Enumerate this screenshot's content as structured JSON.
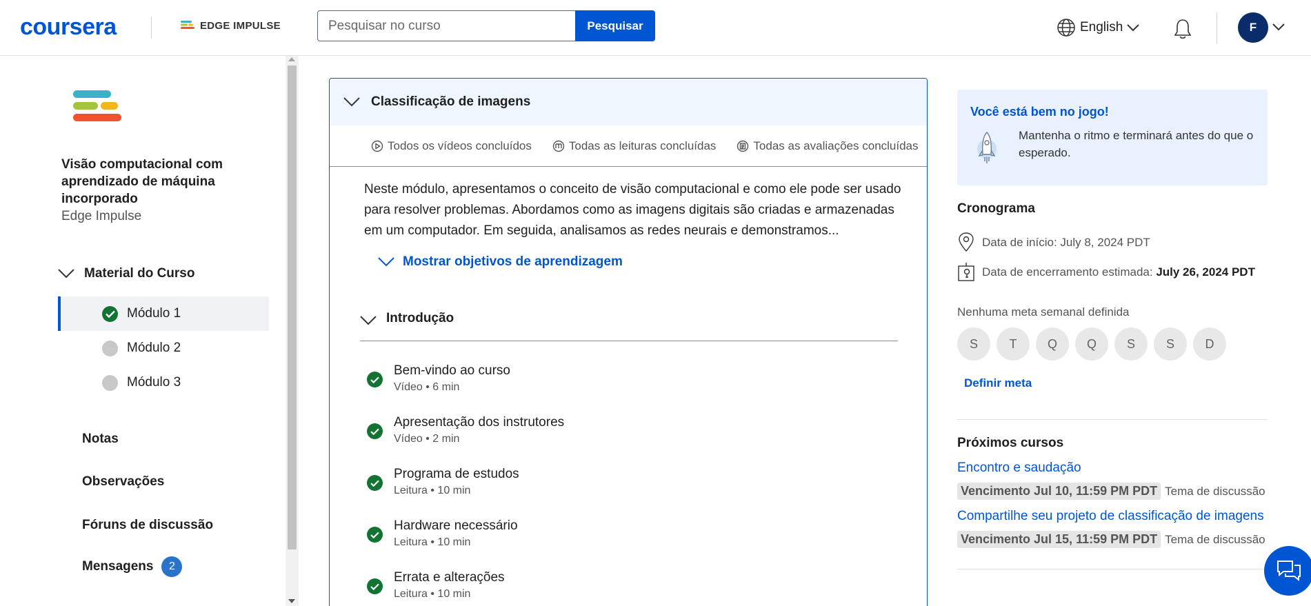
{
  "header": {
    "logo": "coursera",
    "partner_logo": "EDGE IMPULSE",
    "search_placeholder": "Pesquisar no curso",
    "search_button": "Pesquisar",
    "language": "English",
    "avatar_initial": "F"
  },
  "sidebar": {
    "course_title": "Visão computacional com aprendizado de máquina incorporado",
    "course_partner": "Edge Impulse",
    "material_label": "Material do Curso",
    "modules": [
      {
        "label": "Módulo 1",
        "status": "completed"
      },
      {
        "label": "Módulo 2",
        "status": "not-started"
      },
      {
        "label": "Módulo 3",
        "status": "not-started"
      }
    ],
    "links": {
      "notas": "Notas",
      "observacoes": "Observações",
      "foruns": "Fóruns de discussão",
      "mensagens": "Mensagens",
      "mensagens_count": "2"
    }
  },
  "module_card": {
    "title": "Classificação de imagens",
    "summary": {
      "videos": "Todos os vídeos concluídos",
      "readings": "Todas as leituras concluídas",
      "assessments": "Todas as avaliações concluídas"
    },
    "description": "Neste módulo, apresentamos o conceito de visão computacional e como ele pode ser usado para resolver problemas. Abordamos como as imagens digitais são criadas e armazenadas em um computador. Em seguida, analisamos as redes neurais e demonstramos...",
    "objectives_link": "Mostrar objetivos de aprendizagem",
    "lesson_group": "Introdução",
    "items": [
      {
        "title": "Bem-vindo ao curso",
        "meta": "Vídeo • 6 min"
      },
      {
        "title": "Apresentação dos instrutores",
        "meta": "Vídeo • 2 min"
      },
      {
        "title": "Programa de estudos",
        "meta": "Leitura • 10 min"
      },
      {
        "title": "Hardware necessário",
        "meta": "Leitura • 10 min"
      },
      {
        "title": "Errata e alterações",
        "meta": "Leitura • 10 min"
      }
    ]
  },
  "right": {
    "on_track_title": "Você está bem no jogo!",
    "on_track_text": "Mantenha o ritmo e terminará antes do que o esperado.",
    "schedule_title": "Cronograma",
    "start_label": "Data de início: July 8, 2024 PDT",
    "end_label": "Data de encerramento estimada: ",
    "end_value": "July 26, 2024 PDT",
    "goal_note": "Nenhuma meta semanal definida",
    "days": [
      "S",
      "T",
      "Q",
      "Q",
      "S",
      "S",
      "D"
    ],
    "set_goal": "Definir meta",
    "upcoming_title": "Próximos cursos",
    "upcoming": [
      {
        "title": "Encontro e saudação",
        "due": "Vencimento Jul 10, 11:59 PM PDT",
        "type": "Tema de discussão"
      },
      {
        "title": "Compartilhe seu projeto de classificação de imagens",
        "due": "Vencimento Jul 15, 11:59 PM PDT",
        "type": "Tema de discussão"
      }
    ]
  },
  "colors": {
    "brand": "#0056d2",
    "completed": "#137333",
    "avatar": "#0b2c6b"
  }
}
